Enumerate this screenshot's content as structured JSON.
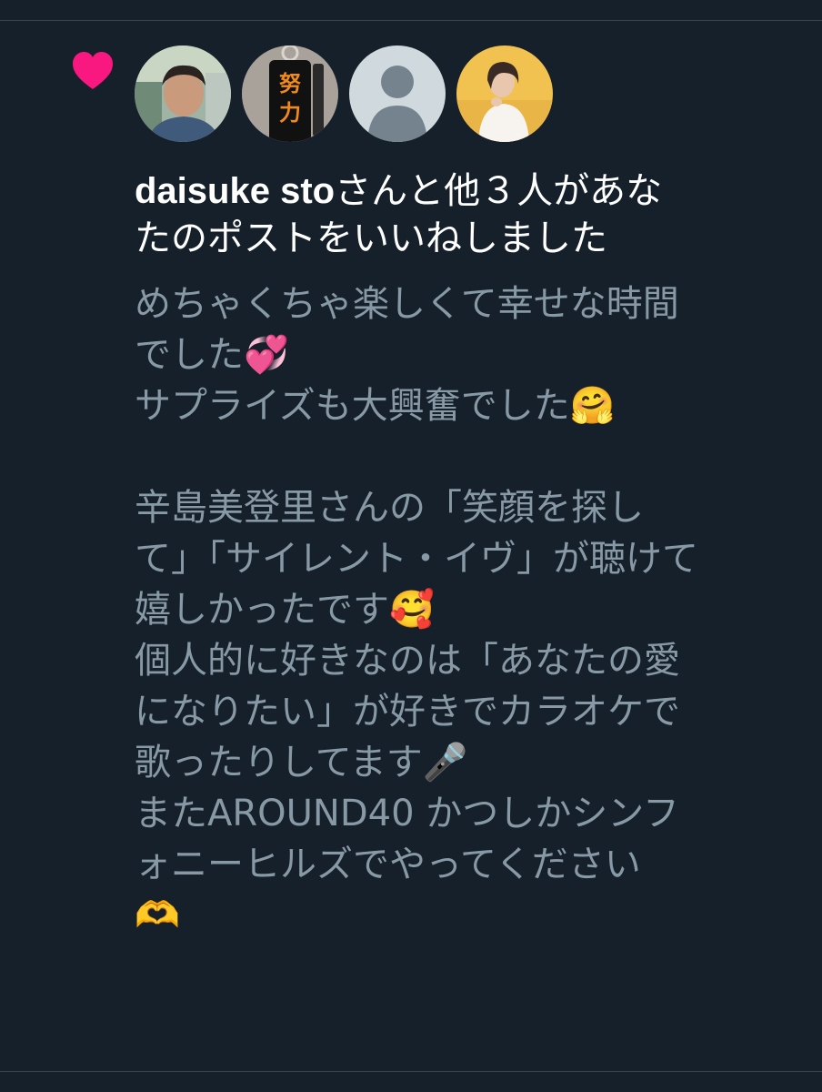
{
  "notification": {
    "user_name": "daisuke sto",
    "action_text_line1": "さんと他３人があな",
    "action_text_line2": "たのポストをいいねしました"
  },
  "avatars": [
    {
      "label": "daisuke sto avatar",
      "icon": "person-photo-avatar"
    },
    {
      "label": "努力 keychain avatar",
      "text_line1": "努",
      "text_line2": "力"
    },
    {
      "label": "default avatar",
      "icon": "default-profile-icon"
    },
    {
      "label": "woman photo avatar",
      "icon": "person-photo-avatar"
    }
  ],
  "post": {
    "lines": [
      "めちゃくちゃ楽しくて幸せな時間",
      "でした💞",
      "サプライズも大興奮でした🤗",
      "",
      "辛島美登里さんの「笑顔を探し",
      "て」「サイレント・イヴ」が聴けて",
      "嬉しかったです🥰",
      "個人的に好きなのは「あなたの愛",
      "になりたい」が好きでカラオケで",
      "歌ったりしてます🎤",
      "またAROUND40 かつしかシンフ",
      "ォニーヒルズでやってください",
      "🫶"
    ]
  },
  "colors": {
    "background": "#15202b",
    "heart": "#f91880",
    "primary_text": "#ffffff",
    "secondary_text": "#8899a6",
    "divider": "#38444d"
  }
}
